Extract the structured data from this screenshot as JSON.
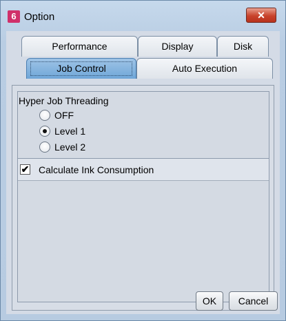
{
  "window": {
    "title": "Option",
    "app_icon_glyph": "6",
    "close_glyph": "✕"
  },
  "tabs": {
    "row1": [
      {
        "label": "Performance"
      },
      {
        "label": "Display"
      },
      {
        "label": "Disk"
      }
    ],
    "row2": [
      {
        "label": "Job Control",
        "active": true
      },
      {
        "label": "Auto Execution"
      }
    ]
  },
  "job_control": {
    "hyper_threading_title": "Hyper Job Threading",
    "options": [
      {
        "label": "OFF",
        "checked": false
      },
      {
        "label": "Level 1",
        "checked": true
      },
      {
        "label": "Level 2",
        "checked": false
      }
    ],
    "ink_consumption": {
      "label": "Calculate Ink Consumption",
      "checked": true,
      "glyph": "✔"
    }
  },
  "buttons": {
    "ok_label": "OK",
    "cancel_label": "Cancel"
  },
  "colors": {
    "active_tab": "#7fb0dd",
    "close_button": "#c8432c"
  }
}
